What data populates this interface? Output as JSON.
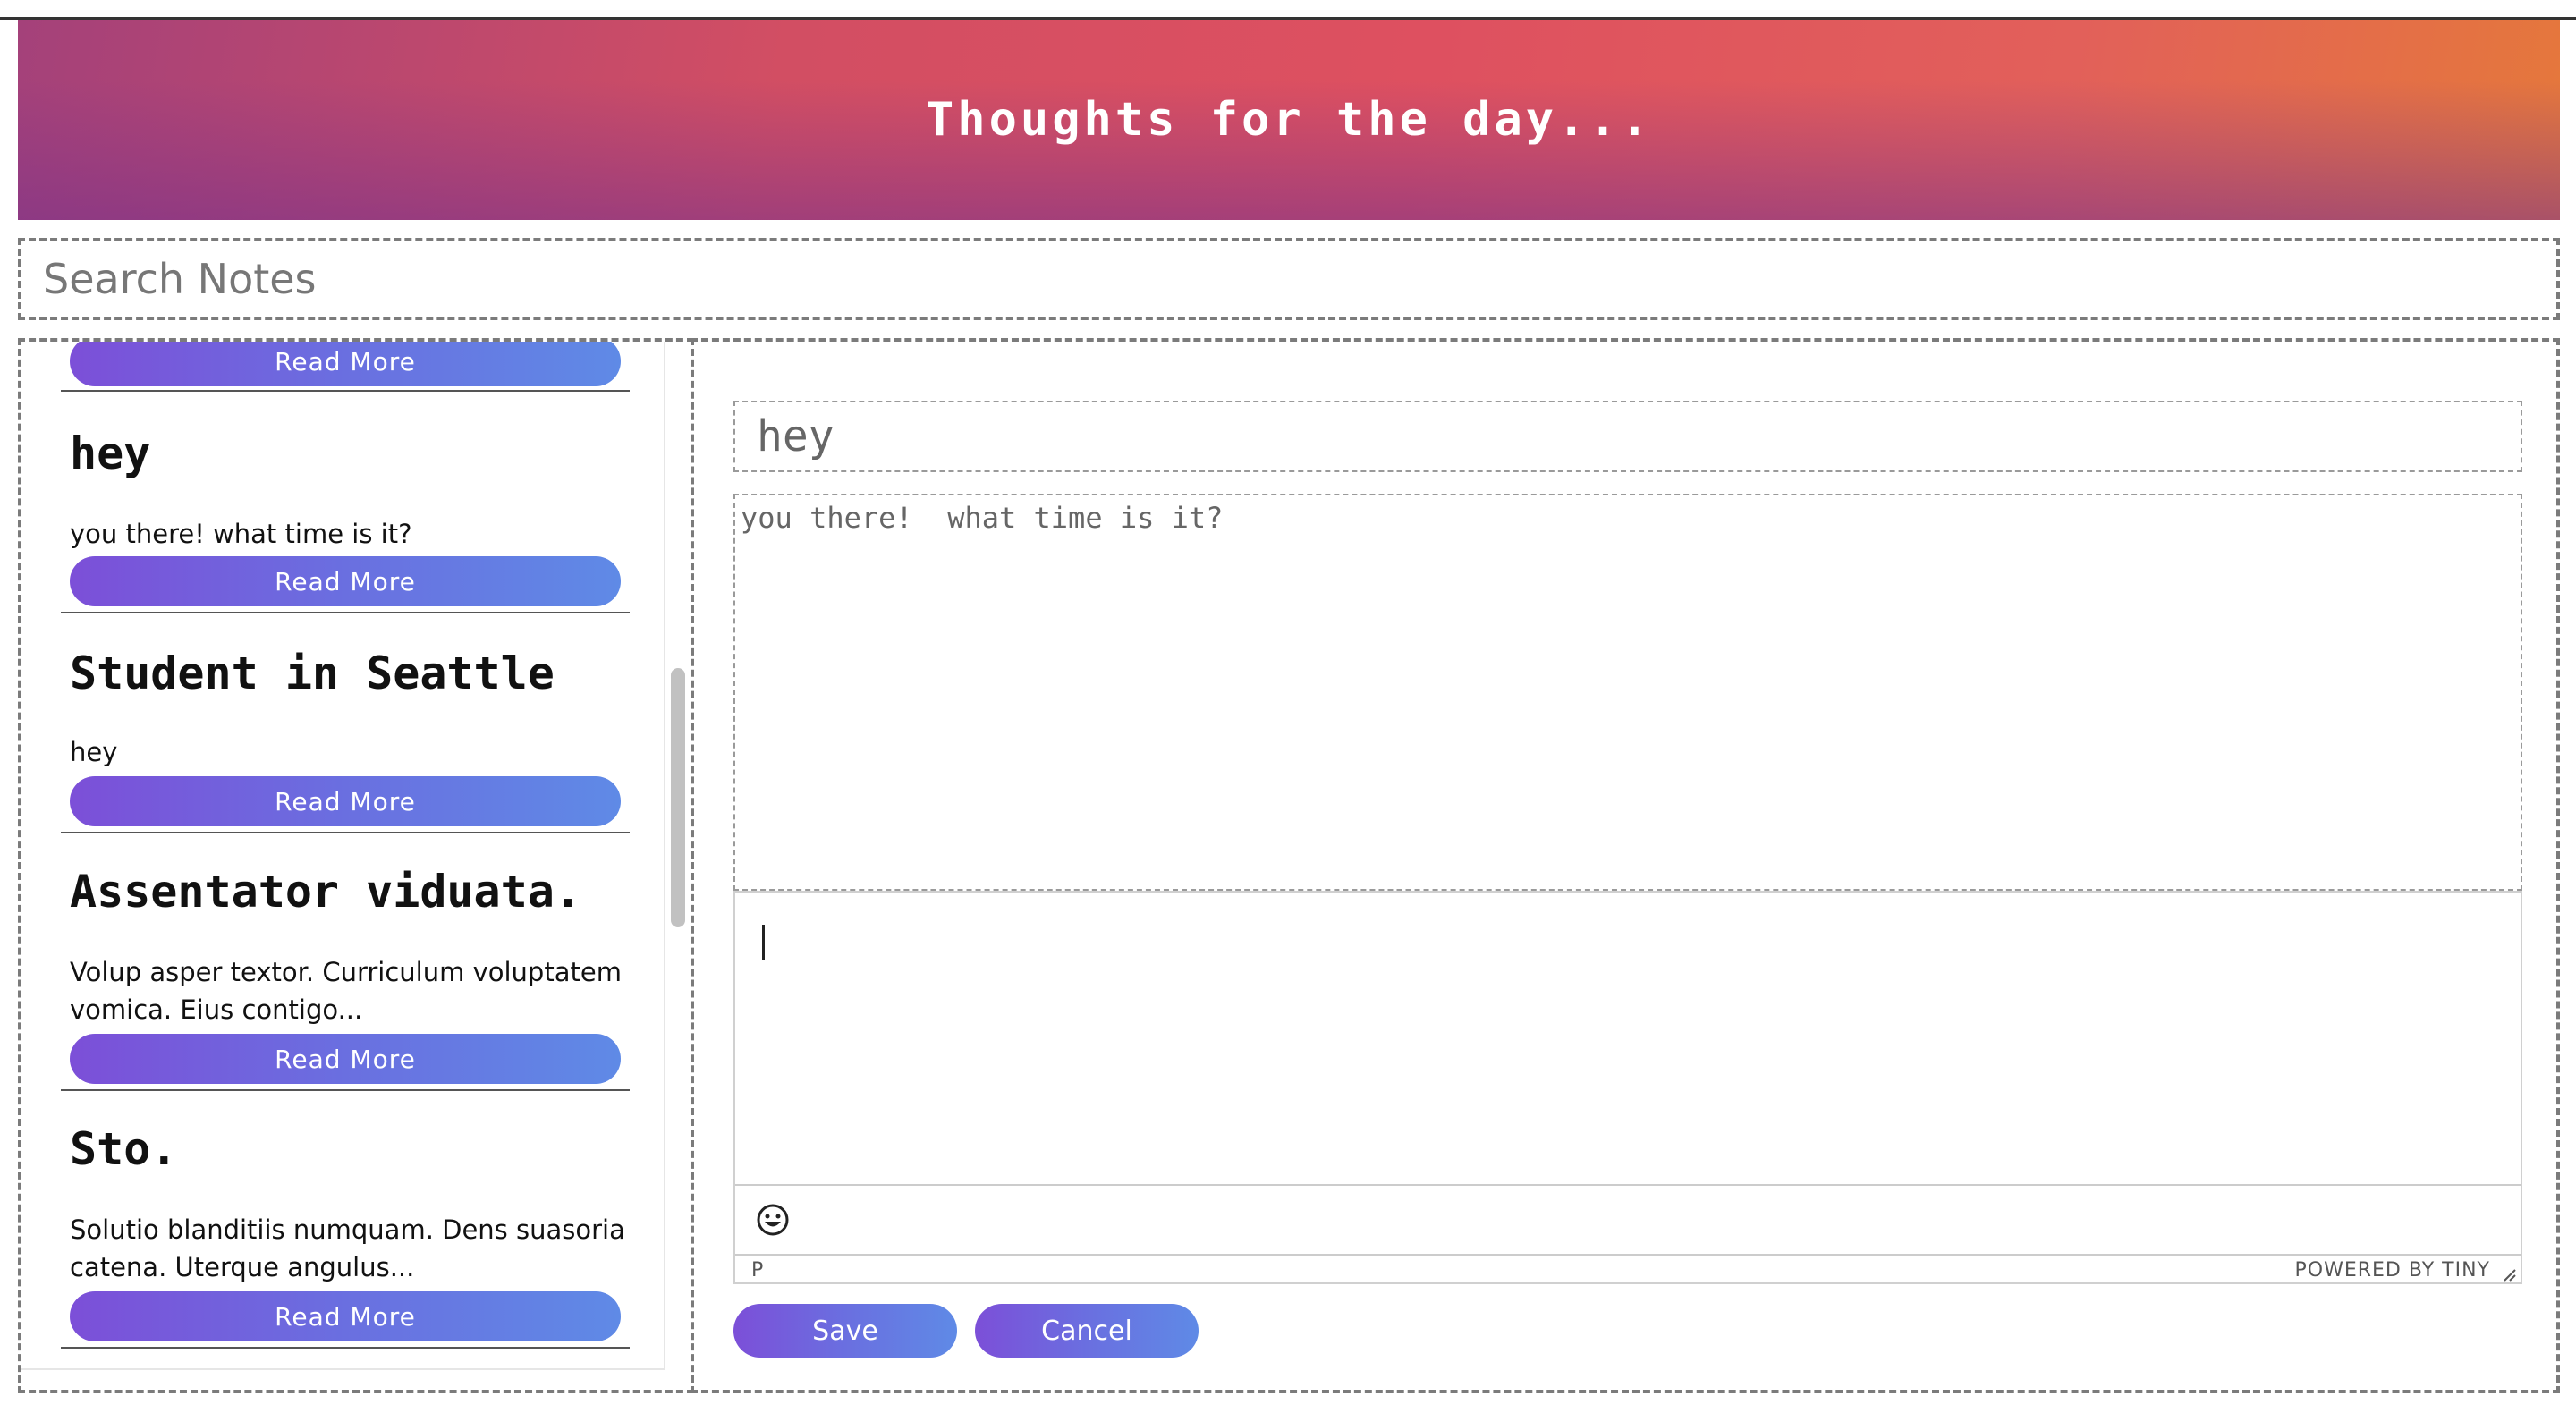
{
  "header": {
    "title": "Thoughts for the day..."
  },
  "search": {
    "placeholder": "Search Notes"
  },
  "sidebar": {
    "read_more_label": "Read More",
    "notes": [
      {
        "title": "hey",
        "body": "you there! what time is it?"
      },
      {
        "title": "Student in Seattle",
        "body": "hey"
      },
      {
        "title": "Assentator viduata.",
        "body": "Volup asper textor. Curriculum voluptatem vomica.  Eius contigo..."
      },
      {
        "title": "Sto.",
        "body": "Solutio blanditiis numquam.  Dens suasoria catena. Uterque angulus..."
      }
    ]
  },
  "editor": {
    "title_value": "hey",
    "body_value": "you there!  what time is it?",
    "statusbar_path": "P",
    "powered_by": "POWERED BY TINY",
    "save_label": "Save",
    "cancel_label": "Cancel"
  },
  "colors": {
    "header_gradient": [
      "#a4417a",
      "#de5060",
      "#e5783b"
    ],
    "button_gradient": [
      "#7c4fd8",
      "#5f8ae6"
    ]
  }
}
